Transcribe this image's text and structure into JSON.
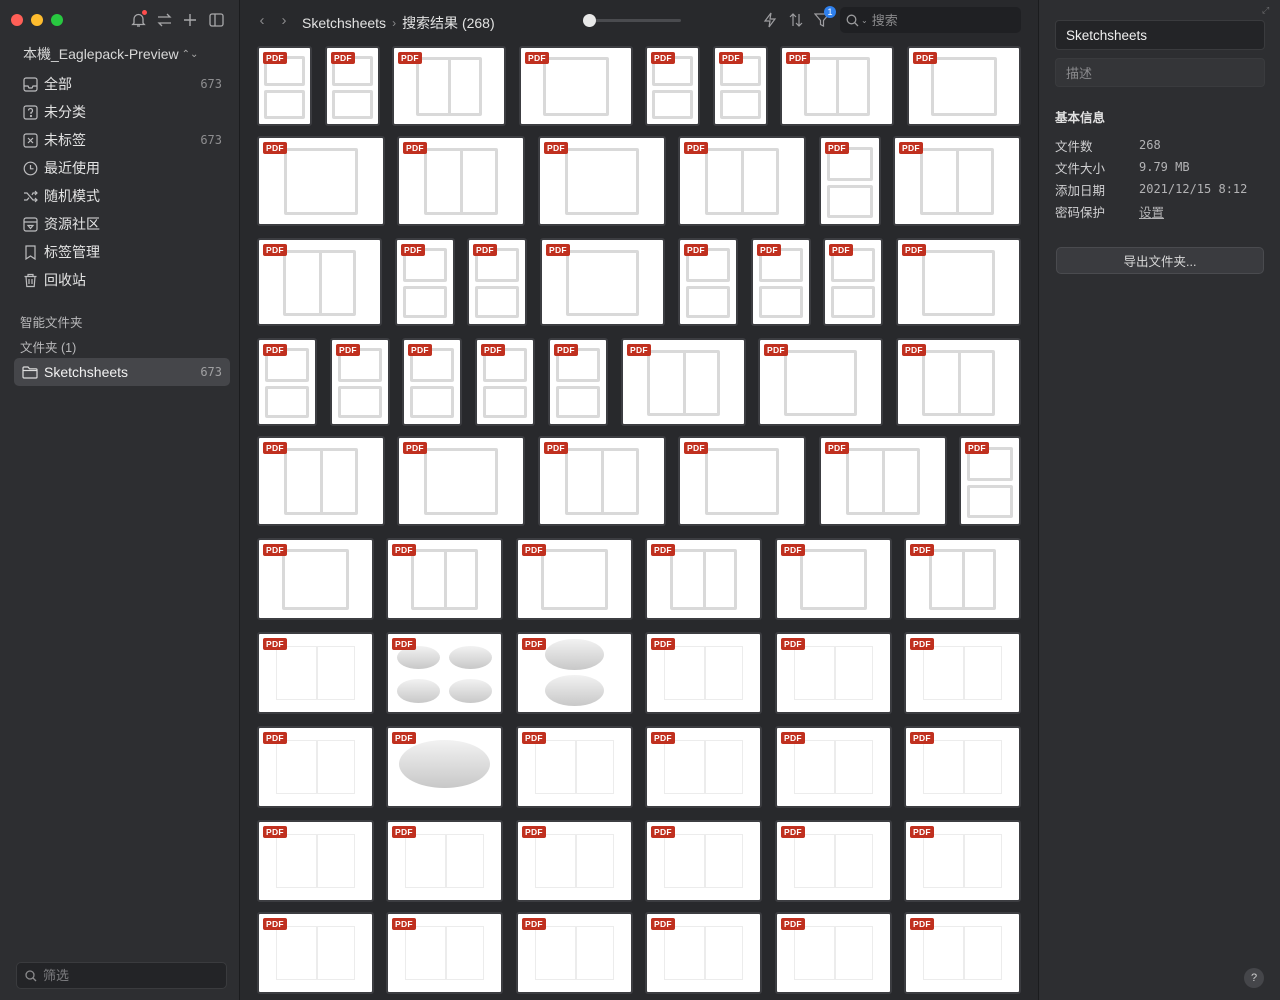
{
  "sidebar": {
    "library_name": "本機_Eaglepack-Preview",
    "nav": [
      {
        "label": "全部",
        "count": "673",
        "icon": "inbox-icon"
      },
      {
        "label": "未分类",
        "count": "",
        "icon": "question-box-icon"
      },
      {
        "label": "未标签",
        "count": "673",
        "icon": "untagged-icon"
      },
      {
        "label": "最近使用",
        "count": "",
        "icon": "clock-icon"
      },
      {
        "label": "随机模式",
        "count": "",
        "icon": "shuffle-icon"
      },
      {
        "label": "资源社区",
        "count": "",
        "icon": "community-icon"
      },
      {
        "label": "标签管理",
        "count": "",
        "icon": "bookmark-icon"
      },
      {
        "label": "回收站",
        "count": "",
        "icon": "trash-icon"
      }
    ],
    "smart_folders_heading": "智能文件夹",
    "folders_heading": "文件夹 (1)",
    "selected_folder": {
      "label": "Sketchsheets",
      "count": "673"
    },
    "filter_placeholder": "筛选"
  },
  "toolbar": {
    "breadcrumb_root": "Sketchsheets",
    "breadcrumb_current": "搜索结果 (268)",
    "thumbnail_size": 0.0,
    "filter_badge": "1",
    "search_placeholder": "搜索"
  },
  "grid": {
    "tag": "PDF"
  },
  "panel": {
    "title": "Sketchsheets",
    "description_placeholder": "描述",
    "basic_info_heading": "基本信息",
    "rows": [
      {
        "key": "文件数",
        "value": "268"
      },
      {
        "key": "文件大小",
        "value": "9.79 MB"
      },
      {
        "key": "添加日期",
        "value": "2021/12/15 8:12"
      }
    ],
    "password_key": "密码保护",
    "password_link": "设置",
    "export_button": "导出文件夹...",
    "help": "?"
  }
}
